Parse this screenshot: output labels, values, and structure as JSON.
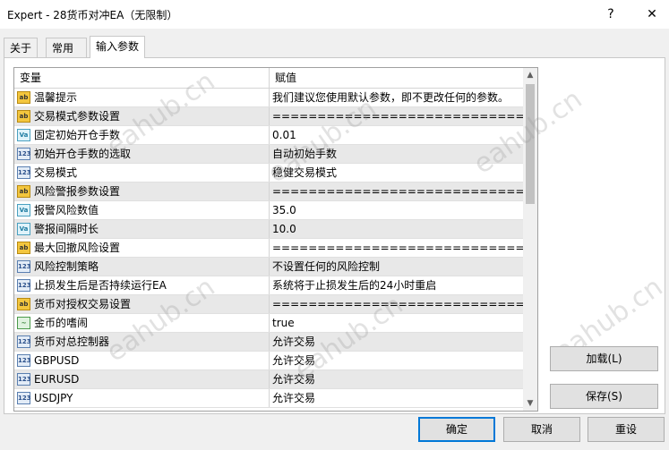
{
  "window": {
    "title": "Expert - 28货币对冲EA（无限制）",
    "help_label": "?",
    "close_label": "✕"
  },
  "tabs": [
    {
      "label": "关于"
    },
    {
      "label": "常用"
    },
    {
      "label": "输入参数",
      "active": true
    }
  ],
  "grid": {
    "headers": {
      "variable": "变量",
      "value": "赋值"
    },
    "rows": [
      {
        "icon": "ab",
        "name": "温馨提示",
        "value": "我们建议您使用默认参数，即不更改任何的参数。"
      },
      {
        "icon": "ab",
        "name": "交易模式参数设置",
        "value": "=============================="
      },
      {
        "icon": "va",
        "name": "固定初始开仓手数",
        "value": "0.01"
      },
      {
        "icon": "123",
        "name": "初始开仓手数的选取",
        "value": "自动初始手数"
      },
      {
        "icon": "123",
        "name": "交易模式",
        "value": "稳健交易模式"
      },
      {
        "icon": "ab",
        "name": "风险警报参数设置",
        "value": "=============================="
      },
      {
        "icon": "va",
        "name": "报警风险数值",
        "value": "35.0"
      },
      {
        "icon": "va",
        "name": "警报间隔时长",
        "value": "10.0"
      },
      {
        "icon": "ab",
        "name": "最大回撤风险设置",
        "value": "=============================="
      },
      {
        "icon": "123",
        "name": "风险控制策略",
        "value": "不设置任何的风险控制"
      },
      {
        "icon": "123",
        "name": "止损发生后是否持续运行EA",
        "value": "系统将于止损发生后的24小时重启"
      },
      {
        "icon": "ab",
        "name": "货币对授权交易设置",
        "value": "=============================="
      },
      {
        "icon": "bool",
        "name": "金币的嗜闹",
        "value": "true"
      },
      {
        "icon": "123",
        "name": "货币对总控制器",
        "value": "允许交易"
      },
      {
        "icon": "123",
        "name": "GBPUSD",
        "value": "允许交易"
      },
      {
        "icon": "123",
        "name": "EURUSD",
        "value": "允许交易"
      },
      {
        "icon": "123",
        "name": "USDJPY",
        "value": "允许交易"
      }
    ]
  },
  "icon_labels": {
    "ab": "ab",
    "va": "Va",
    "123": "123",
    "bool": "~"
  },
  "side_buttons": {
    "load": "加载(L)",
    "save": "保存(S)"
  },
  "bottom_buttons": {
    "ok": "确定",
    "cancel": "取消",
    "reset": "重设"
  },
  "watermark": "eahub.cn",
  "colors": {
    "accent": "#0078d7",
    "row_alt": "#e8e8e8"
  }
}
